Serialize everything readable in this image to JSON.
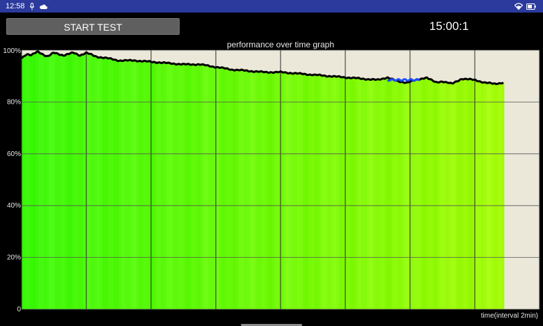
{
  "status_bar": {
    "time": "12:58",
    "icons": [
      "microphone-icon",
      "cloud-icon",
      "wifi-icon",
      "battery-icon"
    ]
  },
  "toolbar": {
    "start_label": "START TEST",
    "timer": "15:00:1"
  },
  "graph": {
    "title": "performance over time graph",
    "x_label": "time(interval 2min)"
  },
  "colors": {
    "status_bar": "#2b3a9c",
    "plot_background": "#ebe8d9",
    "fill_start": "#3ef80c",
    "fill_end": "#a4fb0a",
    "line": "#000000",
    "highlight": "#1e4cff"
  },
  "chart_data": {
    "type": "area",
    "title": "performance over time graph",
    "xlabel": "time(interval 2min)",
    "ylabel": "",
    "y_tick_labels": [
      "0",
      "20%",
      "40%",
      "60%",
      "80%",
      "100%"
    ],
    "ylim": [
      0,
      100
    ],
    "xlim": [
      0,
      16
    ],
    "x_gridline_every": 2,
    "grid": true,
    "x": [
      0,
      0.15,
      0.3,
      0.5,
      0.8,
      1.0,
      1.3,
      1.6,
      1.8,
      2.0,
      2.3,
      2.6,
      3.0,
      3.5,
      4.0,
      4.5,
      5.0,
      5.5,
      6.0,
      6.5,
      7.0,
      7.5,
      8.0,
      8.5,
      9.0,
      9.5,
      10.0,
      10.5,
      11.0,
      11.3,
      11.6,
      11.9,
      12.2,
      12.5,
      12.8,
      13.0,
      13.3,
      13.6,
      14.0,
      14.3,
      14.6,
      14.9
    ],
    "y": [
      97,
      98.5,
      98,
      99.5,
      97.5,
      99,
      98,
      99,
      98,
      99,
      97.5,
      97,
      96,
      96,
      95.5,
      95,
      94.5,
      94.5,
      93.5,
      92.5,
      92,
      91.5,
      91.5,
      91,
      90.5,
      90,
      89.5,
      89,
      88.5,
      89.5,
      88,
      87.5,
      88.5,
      89.5,
      87.5,
      88,
      87,
      89,
      88.5,
      87.5,
      87,
      87.5
    ],
    "highlight_x_range": [
      11.3,
      12.3
    ],
    "highlight_level": 88.5
  }
}
